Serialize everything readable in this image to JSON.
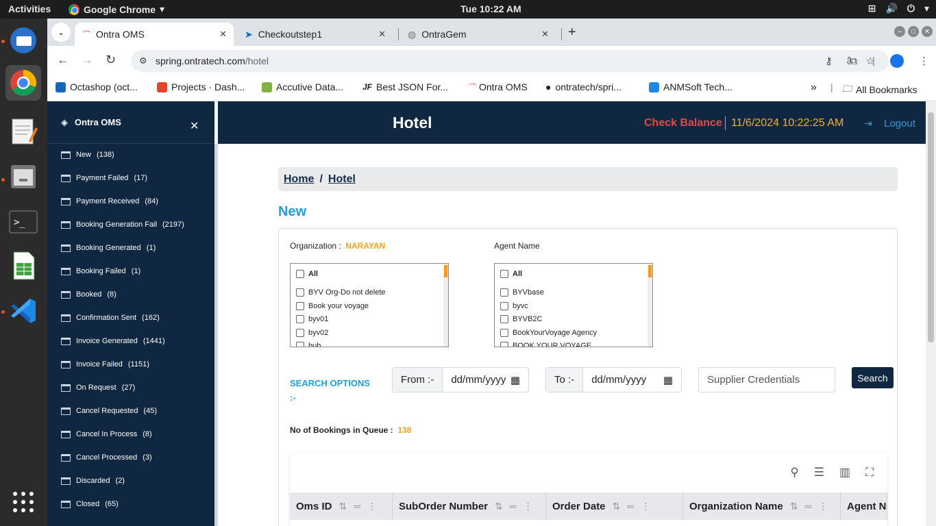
{
  "topbar": {
    "activities": "Activities",
    "app_name": "Google Chrome",
    "clock": "Tue 10:22 AM"
  },
  "browser": {
    "tabs": [
      {
        "label": "Ontra OMS",
        "active": true
      },
      {
        "label": "Checkoutstep1",
        "active": false
      },
      {
        "label": "OntraGem",
        "active": false
      }
    ],
    "url_host": "spring.ontratech.com",
    "url_path": "/hotel",
    "bookmarks": [
      {
        "label": "Octashop (oct...",
        "color": "#1565c0"
      },
      {
        "label": "Projects · Dash...",
        "color": "#e24329"
      },
      {
        "label": "Accutive Data...",
        "color": "#7cb342"
      },
      {
        "label": "Best JSON For...",
        "color": "#333333"
      },
      {
        "label": "Ontra OMS",
        "color": "#e53935"
      },
      {
        "label": "ontratech/spri...",
        "color": "#222222"
      },
      {
        "label": "ANMSoft Tech...",
        "color": "#1e88e5"
      }
    ],
    "bookmarks_more": "»",
    "all_bookmarks": "All Bookmarks"
  },
  "sidebar": {
    "title": "Ontra OMS",
    "items": [
      {
        "label": "New",
        "count": "(138)"
      },
      {
        "label": "Payment Failed",
        "count": "(17)"
      },
      {
        "label": "Payment Received",
        "count": "(84)"
      },
      {
        "label": "Booking Generation Fail",
        "count": "(2197)"
      },
      {
        "label": "Booking Generated",
        "count": "(1)"
      },
      {
        "label": "Booking Failed",
        "count": "(1)"
      },
      {
        "label": "Booked",
        "count": "(8)"
      },
      {
        "label": "Confirmation Sent",
        "count": "(162)"
      },
      {
        "label": "Invoice Generated",
        "count": "(1441)"
      },
      {
        "label": "Invoice Failed",
        "count": "(1151)"
      },
      {
        "label": "On Request",
        "count": "(27)"
      },
      {
        "label": "Cancel Requested",
        "count": "(45)"
      },
      {
        "label": "Cancel In Process",
        "count": "(8)"
      },
      {
        "label": "Cancel Processed",
        "count": "(3)"
      },
      {
        "label": "Discarded",
        "count": "(2)"
      },
      {
        "label": "Closed",
        "count": "(65)"
      }
    ]
  },
  "header": {
    "title": "Hotel",
    "check_balance": "Check Balance",
    "datetime": "11/6/2024  10:22:25 AM",
    "logout": "Logout"
  },
  "breadcrumb": {
    "home": "Home",
    "sep": "/",
    "current": "Hotel"
  },
  "section_title": "New",
  "filters": {
    "org_label": "Organization :",
    "org_value": "NARAYAN",
    "agent_label": "Agent Name",
    "org_list": [
      "All",
      "BYV Org-Do not delete",
      "Book your voyage",
      "byv01",
      "byv02",
      "bub"
    ],
    "agent_list": [
      "All",
      "BYVbase",
      "byvc",
      "BYVB2C",
      "BookYourVoyage Agency",
      "BOOK YOUR VOYAGE"
    ],
    "search_options": "SEARCH OPTIONS",
    "search_options_suffix": ":-",
    "from_label": "From :-",
    "to_label": "To :-",
    "date_placeholder": "dd/mm/yyyy",
    "supplier_placeholder": "Supplier Credentials",
    "search_button": "Search"
  },
  "queue": {
    "label": "No of Bookings in Queue :",
    "value": "138"
  },
  "table": {
    "columns": [
      "Oms ID",
      "SubOrder Number",
      "Order Date",
      "Organization Name",
      "Agent Name"
    ]
  },
  "colors": {
    "navy": "#0f2740",
    "accent_blue": "#1fa0d8",
    "orange": "#f5a21e",
    "red": "#e24a4a"
  }
}
